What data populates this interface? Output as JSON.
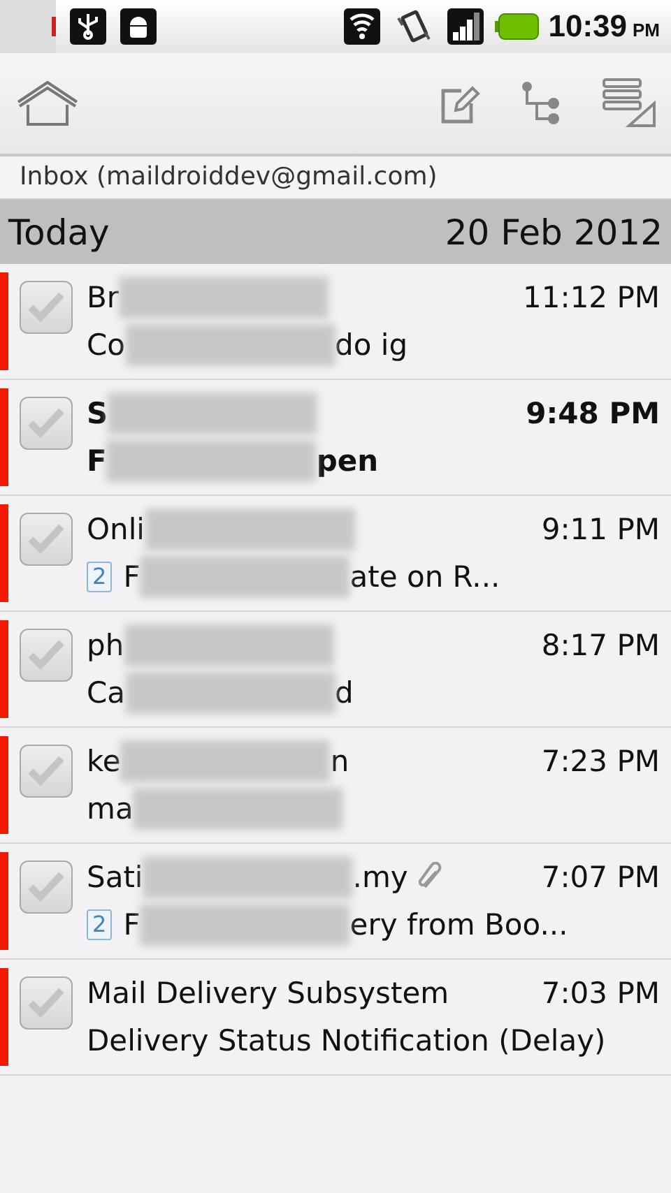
{
  "status_bar": {
    "time": "10:39",
    "ampm": "PM"
  },
  "folder_title": "Inbox (maildroiddev@gmail.com)",
  "section": {
    "label": "Today",
    "date": "20 Feb 2012"
  },
  "messages": [
    {
      "from": [
        {
          "kind": "text",
          "text": "Br"
        },
        {
          "kind": "redacted"
        }
      ],
      "subject": [
        {
          "kind": "text",
          "text": "Co"
        },
        {
          "kind": "redacted"
        },
        {
          "kind": "text",
          "text": " do ig"
        }
      ],
      "time": "11:12 PM",
      "unread": false,
      "checked": false,
      "attachment": false
    },
    {
      "from": [
        {
          "kind": "text",
          "text": "S"
        },
        {
          "kind": "redacted"
        }
      ],
      "subject": [
        {
          "kind": "text",
          "text": "F"
        },
        {
          "kind": "redacted"
        },
        {
          "kind": "text",
          "text": "pen"
        }
      ],
      "time": "9:48 PM",
      "unread": true,
      "checked": false,
      "attachment": false
    },
    {
      "from": [
        {
          "kind": "text",
          "text": "Onli"
        },
        {
          "kind": "redacted"
        }
      ],
      "thread_count": "2",
      "subject": [
        {
          "kind": "text",
          "text": "F"
        },
        {
          "kind": "redacted"
        },
        {
          "kind": "text",
          "text": "ate on R..."
        }
      ],
      "time": "9:11 PM",
      "unread": false,
      "checked": false,
      "attachment": false
    },
    {
      "from": [
        {
          "kind": "text",
          "text": "ph"
        },
        {
          "kind": "redacted"
        }
      ],
      "subject": [
        {
          "kind": "text",
          "text": "Ca"
        },
        {
          "kind": "redacted"
        },
        {
          "kind": "text",
          "text": "d"
        }
      ],
      "time": "8:17 PM",
      "unread": false,
      "checked": false,
      "attachment": false
    },
    {
      "from": [
        {
          "kind": "text",
          "text": "ke"
        },
        {
          "kind": "redacted"
        },
        {
          "kind": "text",
          "text": "n"
        }
      ],
      "subject": [
        {
          "kind": "text",
          "text": "ma"
        },
        {
          "kind": "redacted"
        }
      ],
      "time": "7:23 PM",
      "unread": false,
      "checked": false,
      "attachment": false
    },
    {
      "from": [
        {
          "kind": "text",
          "text": "Sati"
        },
        {
          "kind": "redacted"
        },
        {
          "kind": "text",
          "text": ".my"
        }
      ],
      "thread_count": "2",
      "subject": [
        {
          "kind": "text",
          "text": "F"
        },
        {
          "kind": "redacted"
        },
        {
          "kind": "text",
          "text": "ery from Boo..."
        }
      ],
      "time": "7:07 PM",
      "unread": false,
      "checked": false,
      "attachment": true
    },
    {
      "from": [
        {
          "kind": "text",
          "text": "Mail Delivery Subsystem"
        }
      ],
      "subject": [
        {
          "kind": "text",
          "text": "Delivery Status Notification (Delay)"
        }
      ],
      "time": "7:03 PM",
      "unread": false,
      "checked": false,
      "attachment": false
    }
  ]
}
